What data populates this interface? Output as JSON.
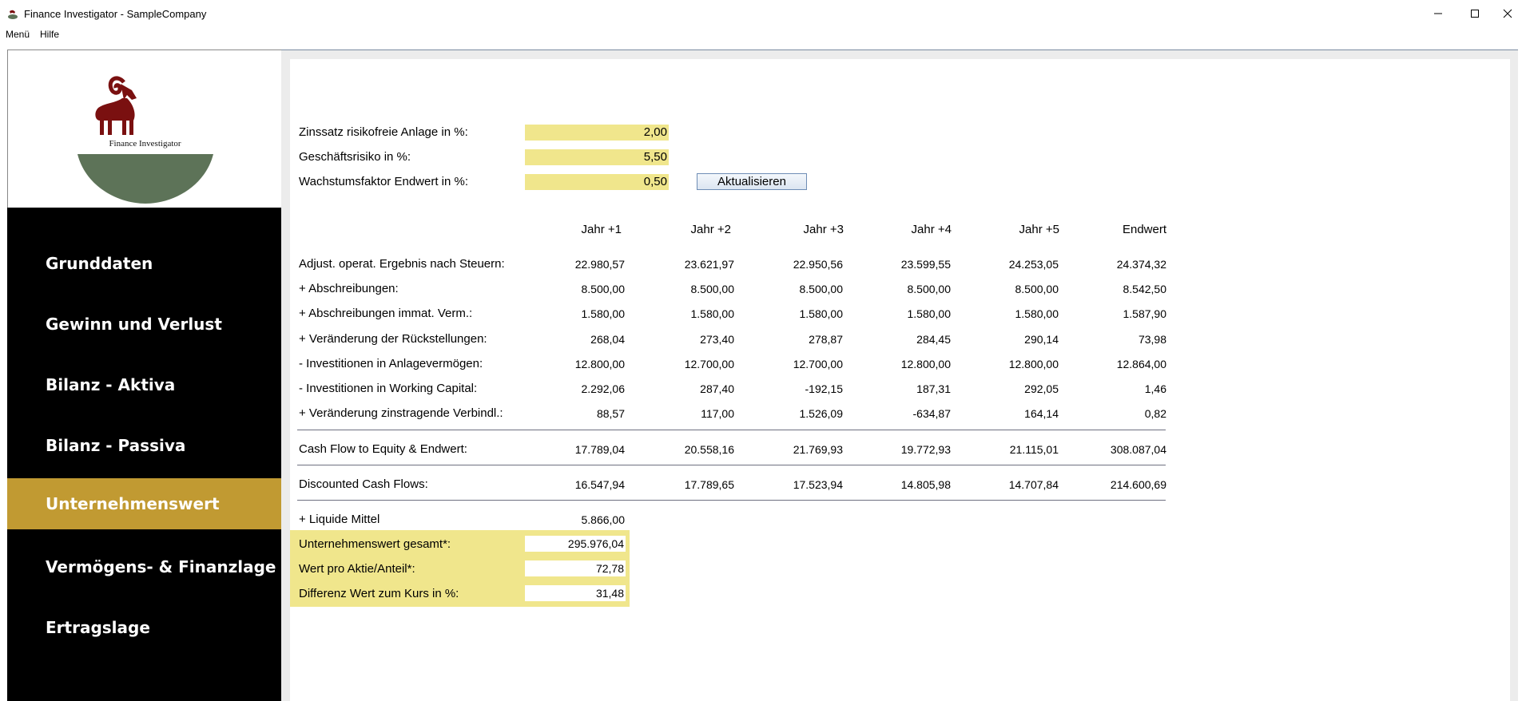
{
  "window": {
    "title": "Finance Investigator - SampleCompany"
  },
  "menu": [
    "Menü",
    "Hilfe"
  ],
  "logo": {
    "caption": "Finance Investigator"
  },
  "nav": [
    "Grunddaten",
    "Gewinn und Verlust",
    "Bilanz - Aktiva",
    "Bilanz - Passiva",
    "Unternehmenswert",
    "Vermögens- & Finanzlage",
    "Ertragslage"
  ],
  "nav_active": "Unternehmenswert",
  "params": [
    {
      "label": "Zinssatz risikofreie Anlage in %:",
      "value": "2,00"
    },
    {
      "label": "Geschäftsrisiko in %:",
      "value": "5,50"
    },
    {
      "label": "Wachstumsfaktor Endwert in %:",
      "value": "0,50"
    }
  ],
  "update_button": "Aktualisieren",
  "columns": [
    "Jahr +1",
    "Jahr +2",
    "Jahr +3",
    "Jahr +4",
    "Jahr +5",
    "Endwert"
  ],
  "rows": [
    {
      "label": "Adjust. operat. Ergebnis nach Steuern:",
      "values": [
        "22.980,57",
        "23.621,97",
        "22.950,56",
        "23.599,55",
        "24.253,05",
        "24.374,32"
      ]
    },
    {
      "label": "+ Abschreibungen:",
      "values": [
        "8.500,00",
        "8.500,00",
        "8.500,00",
        "8.500,00",
        "8.500,00",
        "8.542,50"
      ]
    },
    {
      "label": "+ Abschreibungen immat. Verm.:",
      "values": [
        "1.580,00",
        "1.580,00",
        "1.580,00",
        "1.580,00",
        "1.580,00",
        "1.587,90"
      ]
    },
    {
      "label": "+ Veränderung der Rückstellungen:",
      "values": [
        "268,04",
        "273,40",
        "278,87",
        "284,45",
        "290,14",
        "73,98"
      ]
    },
    {
      "label": "- Investitionen in Anlagevermögen:",
      "values": [
        "12.800,00",
        "12.700,00",
        "12.700,00",
        "12.800,00",
        "12.800,00",
        "12.864,00"
      ]
    },
    {
      "label": "- Investitionen in Working Capital:",
      "values": [
        "2.292,06",
        "287,40",
        "-192,15",
        "187,31",
        "292,05",
        "1,46"
      ]
    },
    {
      "label": "+ Veränderung zinstragende Verbindl.:",
      "values": [
        "88,57",
        "117,00",
        "1.526,09",
        "-634,87",
        "164,14",
        "0,82"
      ]
    }
  ],
  "cashflow": {
    "label": "Cash Flow to Equity & Endwert:",
    "values": [
      "17.789,04",
      "20.558,16",
      "21.769,93",
      "19.772,93",
      "21.115,01",
      "308.087,04"
    ]
  },
  "discounted": {
    "label": "Discounted Cash Flows:",
    "values": [
      "16.547,94",
      "17.789,65",
      "17.523,94",
      "14.805,98",
      "14.707,84",
      "214.600,69"
    ]
  },
  "liquid": {
    "label": "+ Liquide Mittel",
    "value": "5.866,00"
  },
  "results": [
    {
      "label": "Unternehmenswert gesamt*:",
      "value": "295.976,04"
    },
    {
      "label": "Wert pro Aktie/Anteil*:",
      "value": "72,78"
    },
    {
      "label": "Differenz Wert zum Kurs in %:",
      "value": "31,48"
    }
  ],
  "colors": {
    "sidebar": "#000000",
    "active_nav": "#c19a32",
    "field_highlight": "#f0e68c",
    "logo_ram": "#7a1010",
    "logo_hill": "#5d7358"
  },
  "icons": [
    "app-icon",
    "minimize-icon",
    "maximize-icon",
    "close-icon",
    "ram-logo"
  ]
}
